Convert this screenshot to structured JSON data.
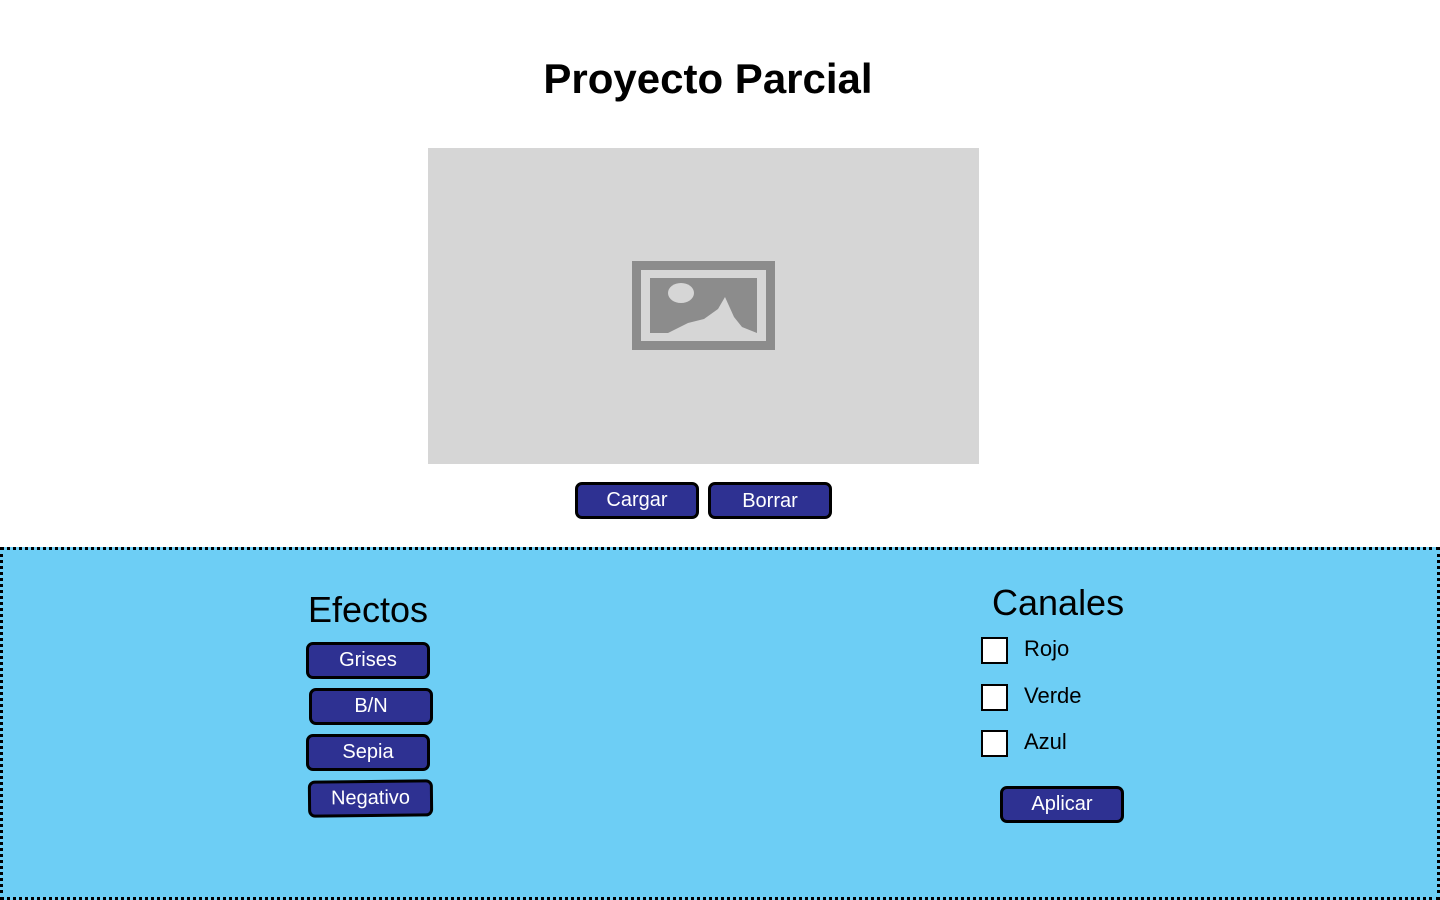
{
  "page": {
    "title": "Proyecto Parcial"
  },
  "image_area": {
    "icon": "image-placeholder-icon"
  },
  "image_actions": {
    "load_label": "Cargar",
    "clear_label": "Borrar"
  },
  "effects": {
    "title": "Efectos",
    "buttons": [
      "Grises",
      "B/N",
      "Sepia",
      "Negativo"
    ]
  },
  "channels": {
    "title": "Canales",
    "options": [
      {
        "label": "Rojo",
        "checked": false
      },
      {
        "label": "Verde",
        "checked": false
      },
      {
        "label": "Azul",
        "checked": false
      }
    ],
    "apply_label": "Aplicar"
  },
  "colors": {
    "button_fill": "#2e3192",
    "button_border": "#000000",
    "panel_background": "#6dcef5",
    "placeholder_background": "#d6d6d6",
    "placeholder_icon": "#8c8c8c"
  }
}
